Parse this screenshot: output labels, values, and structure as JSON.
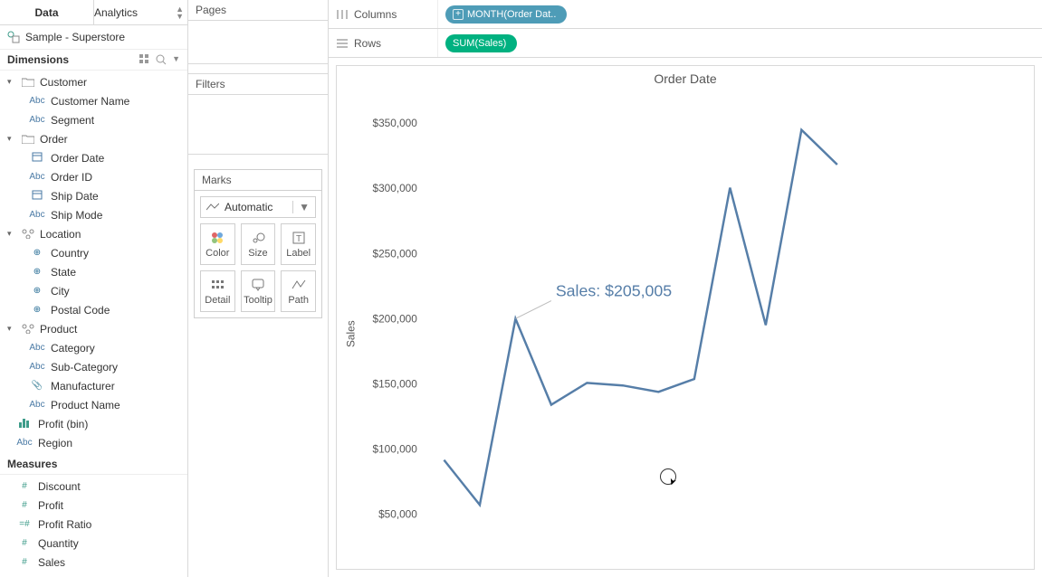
{
  "tabs": {
    "data": "Data",
    "analytics": "Analytics"
  },
  "datasource": "Sample - Superstore",
  "dimensions_label": "Dimensions",
  "measures_label": "Measures",
  "folders": {
    "customer": {
      "label": "Customer",
      "items": [
        "Customer Name",
        "Segment"
      ]
    },
    "order": {
      "label": "Order",
      "items": [
        "Order Date",
        "Order ID",
        "Ship Date",
        "Ship Mode"
      ]
    },
    "location": {
      "label": "Location",
      "items": [
        "Country",
        "State",
        "City",
        "Postal Code"
      ]
    },
    "product": {
      "label": "Product",
      "items": [
        "Category",
        "Sub-Category",
        "Manufacturer",
        "Product Name"
      ]
    }
  },
  "loose_dims": [
    "Profit (bin)",
    "Region"
  ],
  "measures": [
    "Discount",
    "Profit",
    "Profit Ratio",
    "Quantity",
    "Sales"
  ],
  "pages_label": "Pages",
  "filters_label": "Filters",
  "marks_label": "Marks",
  "mark_type": "Automatic",
  "marks_cells": {
    "color": "Color",
    "size": "Size",
    "label": "Label",
    "detail": "Detail",
    "tooltip": "Tooltip",
    "path": "Path"
  },
  "columns_label": "Columns",
  "rows_label": "Rows",
  "columns_pill": "MONTH(Order Dat..",
  "rows_pill": "SUM(Sales)",
  "chart_title": "Order Date",
  "y_axis_label": "Sales",
  "y_ticks": [
    "$350,000",
    "$300,000",
    "$250,000",
    "$200,000",
    "$150,000",
    "$100,000",
    "$50,000"
  ],
  "callout": "Sales: $205,005",
  "chart_data": {
    "type": "line",
    "title": "Order Date",
    "xlabel": "Order Date (Month)",
    "ylabel": "Sales",
    "ylim": [
      50000,
      360000
    ],
    "x": [
      1,
      2,
      3,
      4,
      5,
      6,
      7,
      8,
      9,
      10,
      11,
      12
    ],
    "values": [
      95000,
      60000,
      205000,
      138000,
      155000,
      153000,
      148000,
      158000,
      307000,
      200000,
      352000,
      325000
    ],
    "annotations": [
      {
        "x": 3,
        "y": 205005,
        "text": "Sales: $205,005"
      }
    ]
  }
}
